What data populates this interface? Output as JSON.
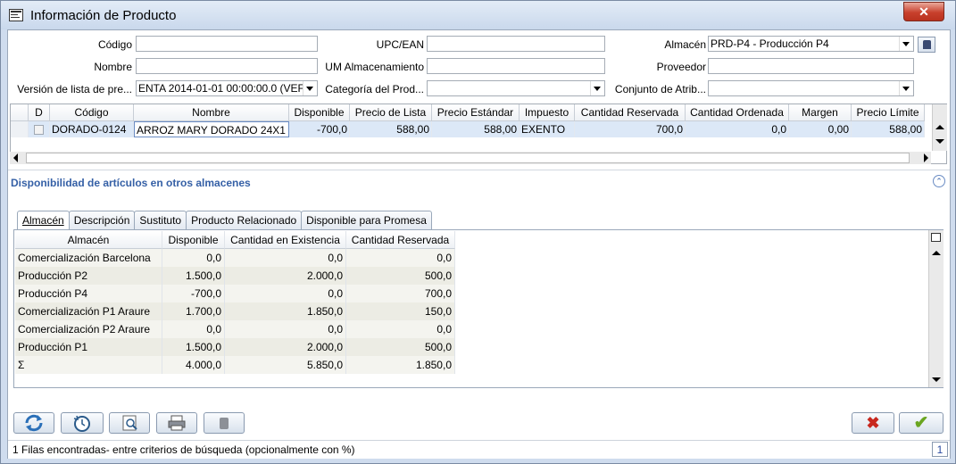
{
  "window": {
    "title": "Información de Producto",
    "close_label": "✕"
  },
  "form": {
    "codigo": {
      "label": "Código",
      "value": ""
    },
    "nombre": {
      "label": "Nombre",
      "value": ""
    },
    "version_lista": {
      "label": "Versión de lista de pre...",
      "value": "ENTA 2014-01-01 00:00:00.0 (VEF"
    },
    "upc": {
      "label": "UPC/EAN",
      "value": ""
    },
    "um_almacenamiento": {
      "label": "UM Almacenamiento",
      "value": ""
    },
    "categoria": {
      "label": "Categoría del Prod...",
      "value": ""
    },
    "almacen": {
      "label": "Almacén",
      "value": "PRD-P4 - Producción P4"
    },
    "proveedor": {
      "label": "Proveedor",
      "value": ""
    },
    "conjunto": {
      "label": "Conjunto de Atrib...",
      "value": ""
    }
  },
  "product_grid": {
    "columns": [
      "D",
      "Código",
      "Nombre",
      "Disponible",
      "Precio de Lista",
      "Precio Estándar",
      "Impuesto",
      "Cantidad Reservada",
      "Cantidad Ordenada",
      "Margen",
      "Precio Límite"
    ],
    "rows": [
      {
        "codigo": "DORADO-0124",
        "nombre": "ARROZ MARY DORADO 24X1",
        "disponible": "-700,0",
        "precio_lista": "588,00",
        "precio_estandar": "588,00",
        "impuesto": "EXENTO",
        "cant_reservada": "700,0",
        "cant_ordenada": "0,0",
        "margen": "0,00",
        "precio_limite": "588,00"
      }
    ]
  },
  "section": {
    "title": "Disponibilidad de artículos en otros almacenes",
    "collapse_icon": "⌃"
  },
  "tabs": [
    {
      "label": "Almacén",
      "active": true
    },
    {
      "label": "Descripción"
    },
    {
      "label": "Sustituto"
    },
    {
      "label": "Producto Relacionado"
    },
    {
      "label": "Disponible para Promesa"
    }
  ],
  "stock_table": {
    "columns": [
      "Almacén",
      "Disponible",
      "Cantidad en Existencia",
      "Cantidad Reservada"
    ],
    "rows": [
      [
        "Comercialización Barcelona",
        "0,0",
        "0,0",
        "0,0"
      ],
      [
        "Producción P2",
        "1.500,0",
        "2.000,0",
        "500,0"
      ],
      [
        "Producción P4",
        "-700,0",
        "0,0",
        "700,0"
      ],
      [
        "Comercialización P1 Araure",
        "1.700,0",
        "1.850,0",
        "150,0"
      ],
      [
        "Comercialización P2 Araure",
        "0,0",
        "0,0",
        "0,0"
      ],
      [
        "Producción P1",
        "1.500,0",
        "2.000,0",
        "500,0"
      ],
      [
        "Σ",
        "4.000,0",
        "5.850,0",
        "1.850,0"
      ]
    ]
  },
  "toolbar": {
    "buttons": [
      "refresh-icon",
      "history-icon",
      "zoom-icon",
      "print-icon",
      "lock-icon"
    ],
    "cancel_icon": "✖",
    "ok_icon": "✔"
  },
  "status": {
    "text": "1 Filas encontradas- entre criterios de búsqueda (opcionalmente con %)",
    "count": "1"
  }
}
